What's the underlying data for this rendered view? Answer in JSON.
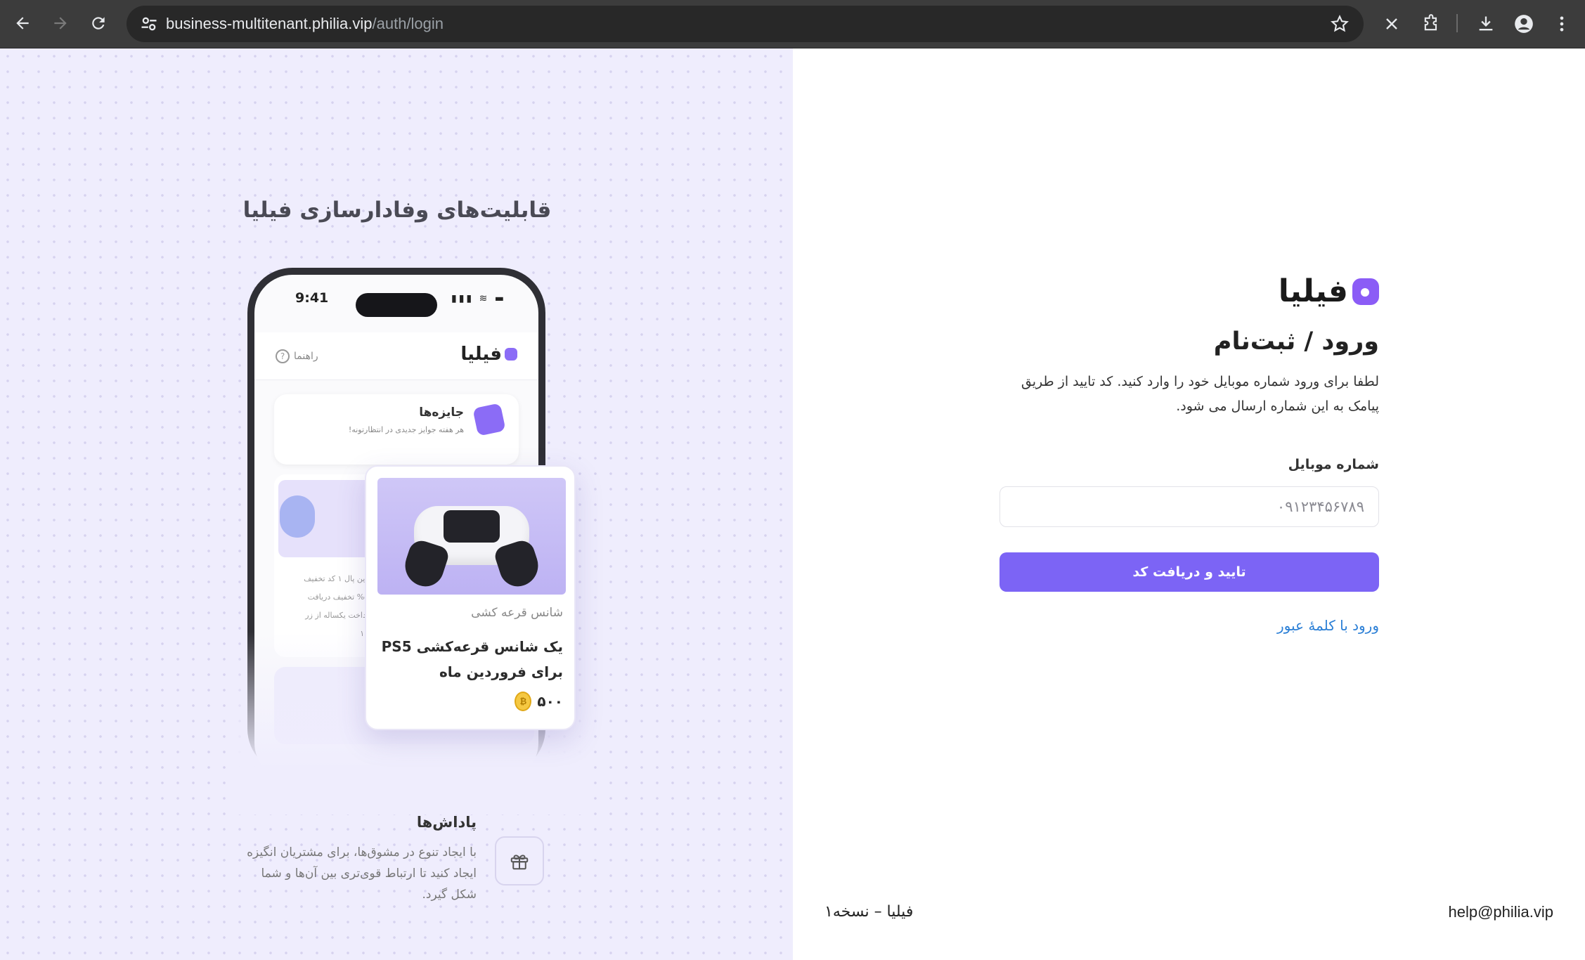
{
  "browser": {
    "url_host": "business-multitenant.philia.vip",
    "url_path": "/auth/login"
  },
  "left": {
    "title": "قابلیت‌های وفادارسازی فیلیا",
    "phone": {
      "time": "9:41",
      "status": "▮▮▮ ≋ ▬",
      "logo": "فیلیا",
      "help": "راهنما",
      "prizes_title": "جایزه‌ها",
      "prizes_sub": "هر هفته جوایز جدیدی در انتظارتونه!",
      "card_text": "زرین پال ۱ کد تخفیف\n%۵۰ تخفیف دریافت\nپرداخت یکساله از زر\n۱۰۰"
    },
    "reward_card": {
      "tag": "شانس قرعه کشی",
      "title": "یک شانس قرعه‌کشی PS5 برای فروردین ماه",
      "price": "۵۰۰"
    },
    "feature": {
      "title": "پاداش‌ها",
      "desc": "با ایجاد تنوع در مشوق‌ها، برای مشتریان انگیزه ایجاد کنید تا ارتباط قوی‌تری بین آن‌ها و شما شکل گیرد."
    }
  },
  "form": {
    "logo": "فیلیا",
    "title": "ورود / ثبت‌نام",
    "desc": "لطفا برای ورود شماره موبایل خود را وارد کنید. کد تایید از طریق پیامک به این شماره ارسال می شود.",
    "field_label": "شماره موبایل",
    "phone_placeholder": "۰۹۱۲۳۴۵۶۷۸۹",
    "submit_label": "تایید و دریافت کد",
    "password_link": "ورود با کلمهٔ عبور"
  },
  "footer": {
    "brand": "فیلیا – نسخه۱",
    "email": "help@philia.vip"
  },
  "colors": {
    "accent": "#7c64f5",
    "link": "#2b7fd6",
    "left_bg": "#efedfd"
  }
}
